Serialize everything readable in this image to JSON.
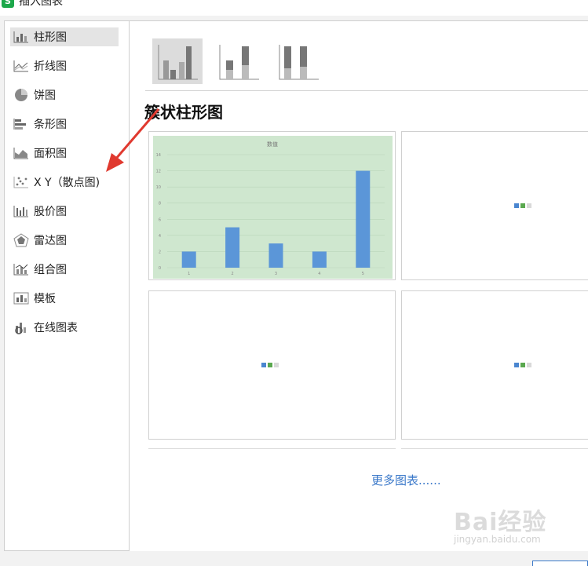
{
  "window": {
    "title": "插入图表",
    "app_icon": "S"
  },
  "sidebar": {
    "items": [
      {
        "label": "柱形图",
        "icon": "column-chart-icon",
        "active": true
      },
      {
        "label": "折线图",
        "icon": "line-chart-icon"
      },
      {
        "label": "饼图",
        "icon": "pie-chart-icon"
      },
      {
        "label": "条形图",
        "icon": "bar-chart-icon"
      },
      {
        "label": "面积图",
        "icon": "area-chart-icon"
      },
      {
        "label": "X Y（散点图)",
        "icon": "scatter-chart-icon"
      },
      {
        "label": "股价图",
        "icon": "stock-chart-icon"
      },
      {
        "label": "雷达图",
        "icon": "radar-chart-icon"
      },
      {
        "label": "组合图",
        "icon": "combo-chart-icon"
      },
      {
        "label": "模板",
        "icon": "template-icon"
      },
      {
        "label": "在线图表",
        "icon": "online-chart-icon"
      }
    ]
  },
  "main": {
    "subtypes": [
      "clustered-column",
      "stacked-column",
      "percent-stacked-column"
    ],
    "section_title": "簇状柱形图",
    "more_link": "更多图表......"
  },
  "chart_data": {
    "type": "bar",
    "title": "数值",
    "categories": [
      "1",
      "2",
      "3",
      "4",
      "5"
    ],
    "values": [
      2,
      5,
      3,
      2,
      12
    ],
    "ylim": [
      0,
      14
    ],
    "yticks": [
      "0",
      "2",
      "4",
      "6",
      "8",
      "10",
      "12",
      "14"
    ],
    "grid": true,
    "bar_color": "#5b96d8",
    "background": "#cfe7cf"
  },
  "loading_dots": [
    "#4a86d0",
    "#5aa84f",
    "#d9d9d9"
  ],
  "watermark": {
    "text": "Bai经验",
    "sub": "jingyan.baidu.com"
  },
  "colors": {
    "accent": "#3a78c9",
    "arrow": "#e0392f"
  }
}
